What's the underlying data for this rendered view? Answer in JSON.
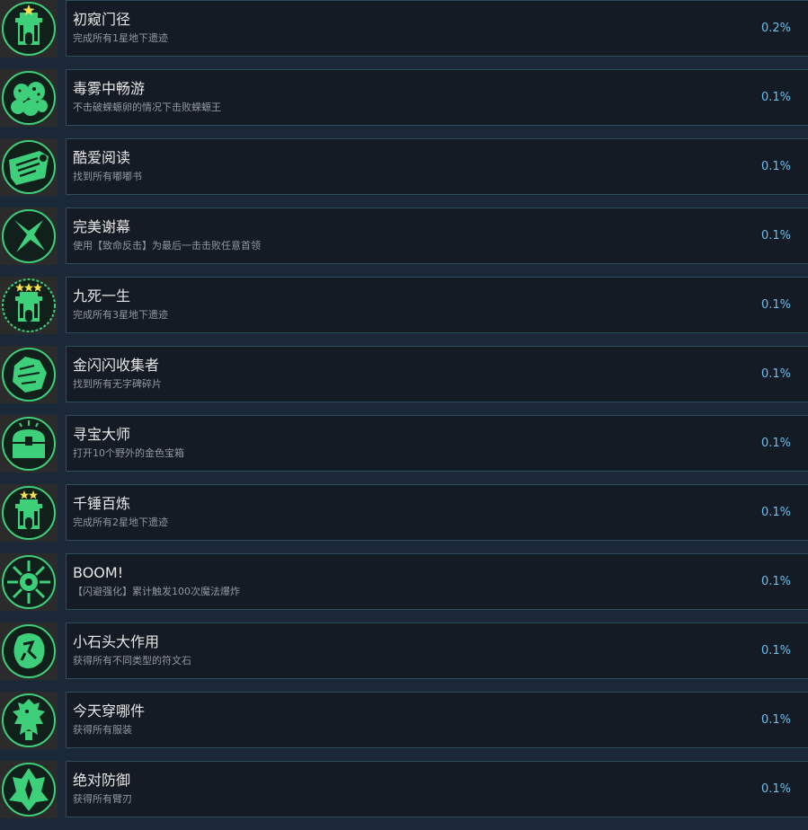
{
  "achievements": [
    {
      "title": "初窥门径",
      "desc": "完成所有1星地下遗迹",
      "percent": "0.2%",
      "icon": "temple-one-star-icon"
    },
    {
      "title": "毒雾中畅游",
      "desc": "不击破蝾螈卵的情况下击败蝾螈王",
      "percent": "0.1%",
      "icon": "eggs-icon"
    },
    {
      "title": "酷爱阅读",
      "desc": "找到所有嘟嘟书",
      "percent": "0.1%",
      "icon": "scroll-icon"
    },
    {
      "title": "完美谢幕",
      "desc": "使用【致命反击】为最后一击击败任意首领",
      "percent": "0.1%",
      "icon": "slash-burst-icon"
    },
    {
      "title": "九死一生",
      "desc": "完成所有3星地下遗迹",
      "percent": "0.1%",
      "icon": "temple-three-star-icon"
    },
    {
      "title": "金闪闪收集者",
      "desc": "找到所有无字碑碎片",
      "percent": "0.1%",
      "icon": "stone-fragment-icon"
    },
    {
      "title": "寻宝大师",
      "desc": "打开10个野外的金色宝箱",
      "percent": "0.1%",
      "icon": "treasure-chest-icon"
    },
    {
      "title": "千锤百炼",
      "desc": "完成所有2星地下遗迹",
      "percent": "0.1%",
      "icon": "temple-two-star-icon"
    },
    {
      "title": "BOOM!",
      "desc": "【闪避强化】累计触发100次魔法爆炸",
      "percent": "0.1%",
      "icon": "explosion-icon"
    },
    {
      "title": "小石头大作用",
      "desc": "获得所有不同类型的符文石",
      "percent": "0.1%",
      "icon": "rune-stone-icon"
    },
    {
      "title": "今天穿哪件",
      "desc": "获得所有服装",
      "percent": "0.1%",
      "icon": "costume-icon"
    },
    {
      "title": "绝对防御",
      "desc": "获得所有臂刃",
      "percent": "0.1%",
      "icon": "arm-blade-icon"
    }
  ],
  "colors": {
    "accent": "#3ecf7a",
    "percent": "#66c0f4",
    "star": "#f4e04d"
  }
}
